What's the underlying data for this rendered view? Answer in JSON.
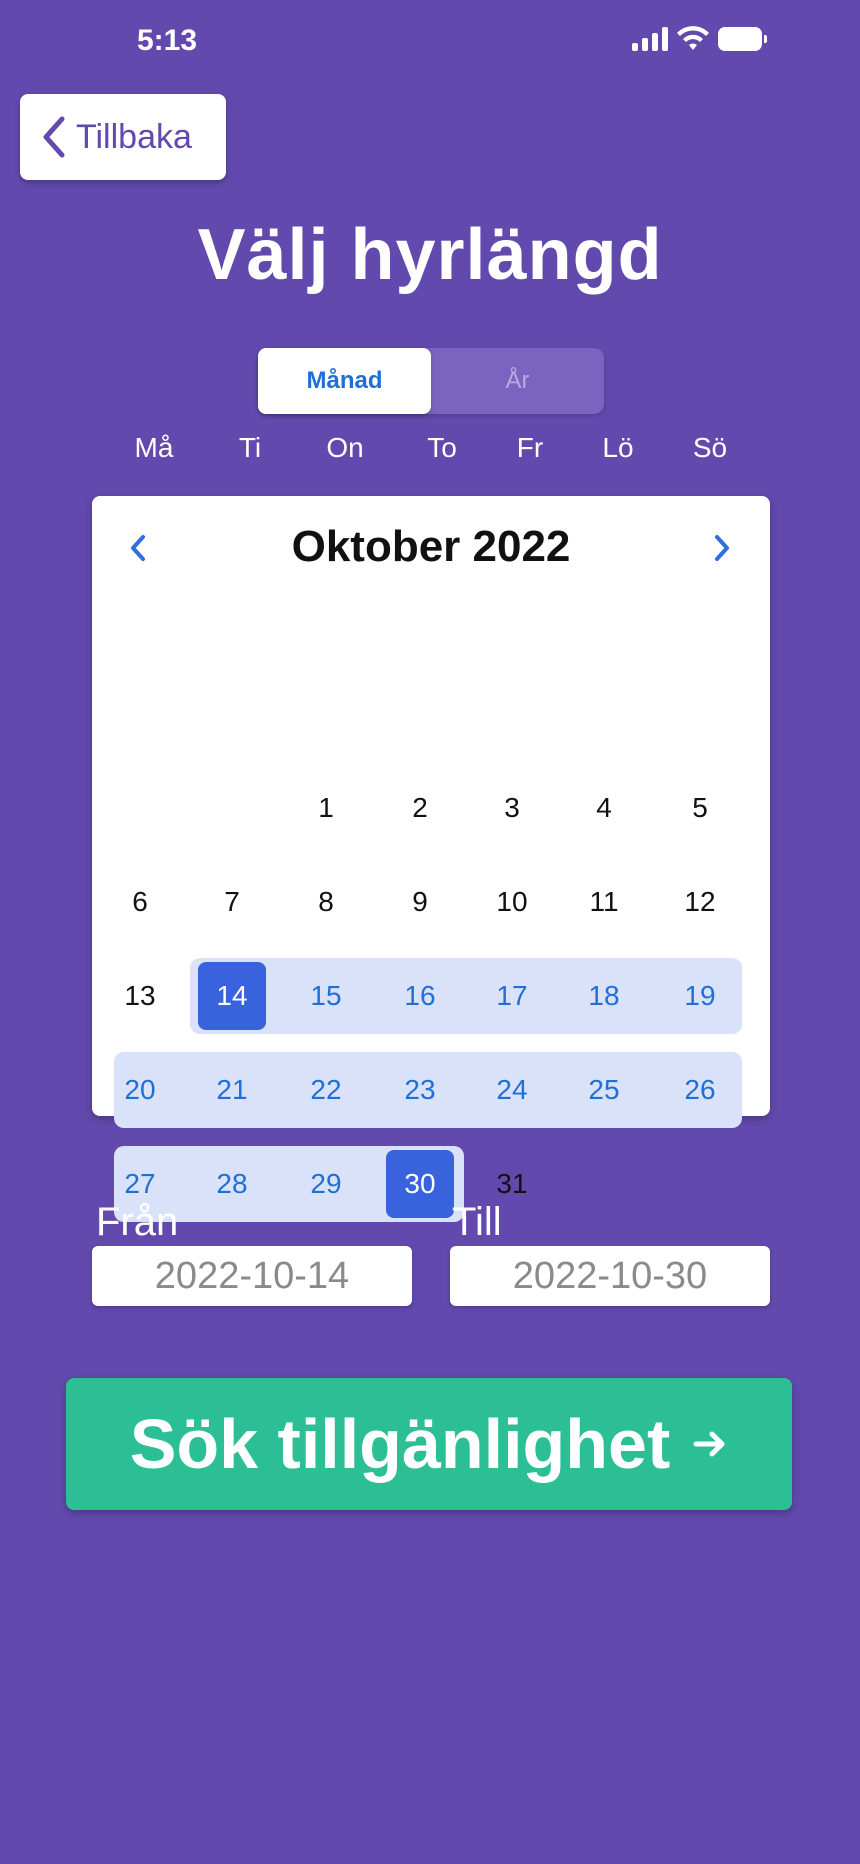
{
  "status_bar": {
    "time": "5:13"
  },
  "header": {
    "back_label": "Tillbaka",
    "title": "Välj hyrlängd"
  },
  "segment": {
    "tabs": [
      {
        "label": "Månad",
        "active": true
      },
      {
        "label": "År",
        "active": false
      }
    ]
  },
  "weekdays": [
    "Må",
    "Ti",
    "On",
    "To",
    "Fr",
    "Lö",
    "Sö"
  ],
  "calendar": {
    "month_label": "Oktober 2022",
    "leading_blank_days": 2,
    "days_in_month": 31,
    "range_start": 14,
    "range_end": 30
  },
  "date_range": {
    "from_label": "Från",
    "from_value": "2022-10-14",
    "till_label": "Till",
    "till_value": "2022-10-30"
  },
  "search_button": {
    "label": "Sök tillgänlighet"
  },
  "colors": {
    "background": "#6249ad",
    "accent_blue": "#3863dd",
    "range_fill": "#d9e2f8",
    "cta_green": "#2cbf95"
  }
}
